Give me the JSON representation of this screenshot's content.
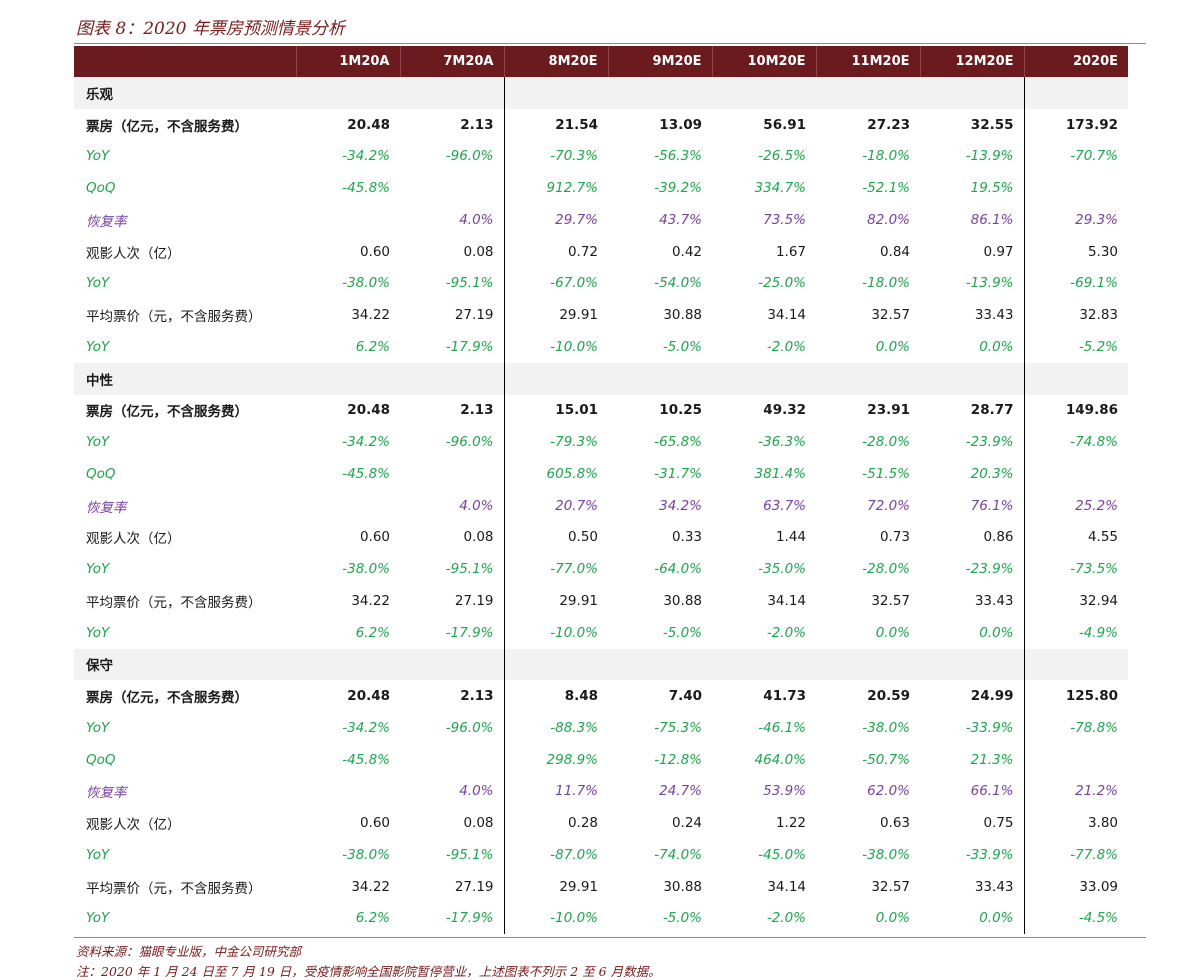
{
  "title": "图表 8：2020 年票房预测情景分析",
  "headers": [
    "",
    "1M20A",
    "7M20A",
    "8M20E",
    "9M20E",
    "10M20E",
    "11M20E",
    "12M20E",
    "2020E"
  ],
  "rows": [
    {
      "type": "sec",
      "cells": [
        "乐观",
        "",
        "",
        "",
        "",
        "",
        "",
        "",
        ""
      ]
    },
    {
      "type": "bold",
      "cells": [
        "票房（亿元，不含服务费）",
        "20.48",
        "2.13",
        "21.54",
        "13.09",
        "56.91",
        "27.23",
        "32.55",
        "173.92"
      ]
    },
    {
      "type": "green",
      "cells": [
        "YoY",
        "-34.2%",
        "-96.0%",
        "-70.3%",
        "-56.3%",
        "-26.5%",
        "-18.0%",
        "-13.9%",
        "-70.7%"
      ]
    },
    {
      "type": "green",
      "cells": [
        "QoQ",
        "-45.8%",
        "",
        "912.7%",
        "-39.2%",
        "334.7%",
        "-52.1%",
        "19.5%",
        ""
      ]
    },
    {
      "type": "purple",
      "cells": [
        "恢复率",
        "",
        "4.0%",
        "29.7%",
        "43.7%",
        "73.5%",
        "82.0%",
        "86.1%",
        "29.3%"
      ]
    },
    {
      "type": "plain",
      "cells": [
        "观影人次（亿）",
        "0.60",
        "0.08",
        "0.72",
        "0.42",
        "1.67",
        "0.84",
        "0.97",
        "5.30"
      ]
    },
    {
      "type": "green",
      "cells": [
        "YoY",
        "-38.0%",
        "-95.1%",
        "-67.0%",
        "-54.0%",
        "-25.0%",
        "-18.0%",
        "-13.9%",
        "-69.1%"
      ]
    },
    {
      "type": "plain",
      "cells": [
        "平均票价（元，不含服务费）",
        "34.22",
        "27.19",
        "29.91",
        "30.88",
        "34.14",
        "32.57",
        "33.43",
        "32.83"
      ]
    },
    {
      "type": "green",
      "cells": [
        "YoY",
        "6.2%",
        "-17.9%",
        "-10.0%",
        "-5.0%",
        "-2.0%",
        "0.0%",
        "0.0%",
        "-5.2%"
      ]
    },
    {
      "type": "sec",
      "cells": [
        "中性",
        "",
        "",
        "",
        "",
        "",
        "",
        "",
        ""
      ]
    },
    {
      "type": "bold",
      "cells": [
        "票房（亿元，不含服务费）",
        "20.48",
        "2.13",
        "15.01",
        "10.25",
        "49.32",
        "23.91",
        "28.77",
        "149.86"
      ]
    },
    {
      "type": "green",
      "cells": [
        "YoY",
        "-34.2%",
        "-96.0%",
        "-79.3%",
        "-65.8%",
        "-36.3%",
        "-28.0%",
        "-23.9%",
        "-74.8%"
      ]
    },
    {
      "type": "green",
      "cells": [
        "QoQ",
        "-45.8%",
        "",
        "605.8%",
        "-31.7%",
        "381.4%",
        "-51.5%",
        "20.3%",
        ""
      ]
    },
    {
      "type": "purple",
      "cells": [
        "恢复率",
        "",
        "4.0%",
        "20.7%",
        "34.2%",
        "63.7%",
        "72.0%",
        "76.1%",
        "25.2%"
      ]
    },
    {
      "type": "plain",
      "cells": [
        "观影人次（亿）",
        "0.60",
        "0.08",
        "0.50",
        "0.33",
        "1.44",
        "0.73",
        "0.86",
        "4.55"
      ]
    },
    {
      "type": "green",
      "cells": [
        "YoY",
        "-38.0%",
        "-95.1%",
        "-77.0%",
        "-64.0%",
        "-35.0%",
        "-28.0%",
        "-23.9%",
        "-73.5%"
      ]
    },
    {
      "type": "plain",
      "cells": [
        "平均票价（元，不含服务费）",
        "34.22",
        "27.19",
        "29.91",
        "30.88",
        "34.14",
        "32.57",
        "33.43",
        "32.94"
      ]
    },
    {
      "type": "green",
      "cells": [
        "YoY",
        "6.2%",
        "-17.9%",
        "-10.0%",
        "-5.0%",
        "-2.0%",
        "0.0%",
        "0.0%",
        "-4.9%"
      ]
    },
    {
      "type": "sec",
      "cells": [
        "保守",
        "",
        "",
        "",
        "",
        "",
        "",
        "",
        ""
      ]
    },
    {
      "type": "bold",
      "cells": [
        "票房（亿元，不含服务费）",
        "20.48",
        "2.13",
        "8.48",
        "7.40",
        "41.73",
        "20.59",
        "24.99",
        "125.80"
      ]
    },
    {
      "type": "green",
      "cells": [
        "YoY",
        "-34.2%",
        "-96.0%",
        "-88.3%",
        "-75.3%",
        "-46.1%",
        "-38.0%",
        "-33.9%",
        "-78.8%"
      ]
    },
    {
      "type": "green",
      "cells": [
        "QoQ",
        "-45.8%",
        "",
        "298.9%",
        "-12.8%",
        "464.0%",
        "-50.7%",
        "21.3%",
        ""
      ]
    },
    {
      "type": "purple",
      "cells": [
        "恢复率",
        "",
        "4.0%",
        "11.7%",
        "24.7%",
        "53.9%",
        "62.0%",
        "66.1%",
        "21.2%"
      ]
    },
    {
      "type": "plain",
      "cells": [
        "观影人次（亿）",
        "0.60",
        "0.08",
        "0.28",
        "0.24",
        "1.22",
        "0.63",
        "0.75",
        "3.80"
      ]
    },
    {
      "type": "green",
      "cells": [
        "YoY",
        "-38.0%",
        "-95.1%",
        "-87.0%",
        "-74.0%",
        "-45.0%",
        "-38.0%",
        "-33.9%",
        "-77.8%"
      ]
    },
    {
      "type": "plain",
      "cells": [
        "平均票价（元，不含服务费）",
        "34.22",
        "27.19",
        "29.91",
        "30.88",
        "34.14",
        "32.57",
        "33.43",
        "33.09"
      ]
    },
    {
      "type": "green",
      "cells": [
        "YoY",
        "6.2%",
        "-17.9%",
        "-10.0%",
        "-5.0%",
        "-2.0%",
        "0.0%",
        "0.0%",
        "-4.5%"
      ]
    }
  ],
  "source": "资料来源：猫眼专业版，中金公司研究部",
  "note": "注：2020 年 1 月 24 日至 7 月 19 日，受疫情影响全国影院暂停营业，上述图表不列示 2 至 6 月数据。",
  "colors": {
    "header_bg": "#6b1b1e",
    "green": "#1aa84a",
    "purple": "#7a3fa6",
    "section_bg": "#f2f2f2",
    "title": "#7b1a1a"
  }
}
